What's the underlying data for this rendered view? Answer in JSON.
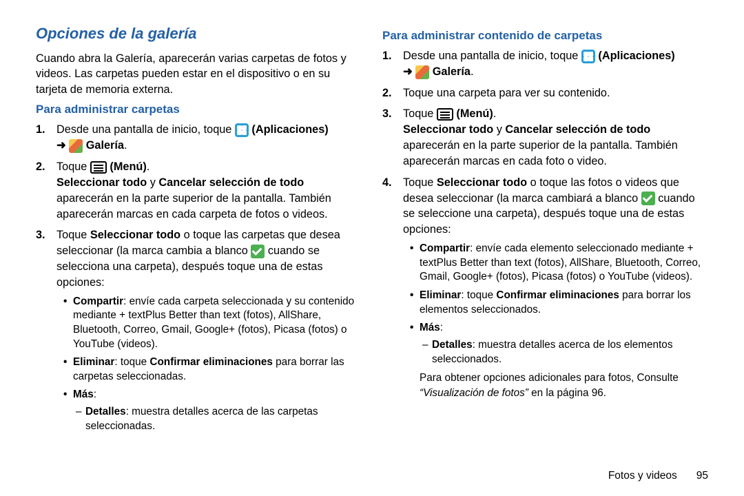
{
  "title": "Opciones de la galería",
  "intro": "Cuando abra la Galería, aparecerán varias carpetas de fotos y videos. Las carpetas pueden estar en el dispositivo o en su tarjeta de memoria externa.",
  "sec1_h": "Para administrar carpetas",
  "s1l1a": "Desde una pantalla de inicio, toque ",
  "s1l1b": " (Aplicaciones) ",
  "s1l1c": " Galería",
  "s1l2a": "Toque ",
  "s1l2b": " (Menú)",
  "s1aft1a": "Seleccionar todo",
  "s1aft1b": " y ",
  "s1aft1c": "Cancelar selección de todo",
  "s1aft2": " aparecerán en la parte superior de la pantalla. También aparecerán marcas en cada carpeta de fotos o videos.",
  "s1l3a": "Toque ",
  "s1l3b": "Seleccionar todo",
  "s1l3c": " o toque las carpetas que desea seleccionar (la marca cambia a blanco ",
  "s1l3d": " cuando se selecciona una carpeta), después toque una de estas opciones:",
  "b1a_t": "Compartir",
  "b1a": ": envíe cada carpeta seleccionada y su contenido mediante + textPlus Better than text (fotos), AllShare, Bluetooth, Correo, Gmail, Google+ (fotos), Picasa (fotos) o YouTube (videos).",
  "b1b_t": "Eliminar",
  "b1b1": ": toque ",
  "b1b2": "Confirmar eliminaciones",
  "b1b3": " para borrar las carpetas seleccionadas.",
  "b1c_t": "Más",
  "b1c_d1": "Detalles",
  "b1c_d2": ": muestra detalles acerca de las carpetas seleccionadas.",
  "sec2_h": "Para administrar contenido de carpetas",
  "s2l1a": "Desde una pantalla de inicio, toque ",
  "s2l1b": " (Aplicaciones) ",
  "s2l1c": " Galería",
  "s2l2": "Toque una carpeta para ver su contenido.",
  "s2l3a": "Toque ",
  "s2l3b": " (Menú)",
  "s2aft1a": "Seleccionar todo",
  "s2aft1b": " y ",
  "s2aft1c": "Cancelar selección de todo",
  "s2aft2": " aparecerán en la parte superior de la pantalla. También aparecerán marcas en cada foto o video.",
  "s2l4a": "Toque ",
  "s2l4b": "Seleccionar todo",
  "s2l4c": " o toque las fotos o videos que desea seleccionar (la marca cambiará a blanco ",
  "s2l4d": " cuando se seleccione una carpeta), después toque una de estas opciones:",
  "b2a_t": "Compartir",
  "b2a": ": envíe cada elemento seleccionado mediante + textPlus Better than text (fotos), AllShare, Bluetooth, Correo, Gmail, Google+ (fotos), Picasa (fotos) o YouTube (videos).",
  "b2b_t": "Eliminar",
  "b2b1": ": toque ",
  "b2b2": "Confirmar eliminaciones",
  "b2b3": " para borrar los elementos seleccionados.",
  "b2c_t": "Más",
  "b2c_d1": "Detalles",
  "b2c_d2": ": muestra detalles acerca de los elementos seleccionados.",
  "endnote1": "Para obtener opciones adicionales para fotos, Consulte ",
  "endnote2": "“Visualización de fotos”",
  "endnote3": " en la página 96.",
  "foot_section": "Fotos y videos",
  "foot_page": "95",
  "arrow": "➜",
  "dot": "."
}
